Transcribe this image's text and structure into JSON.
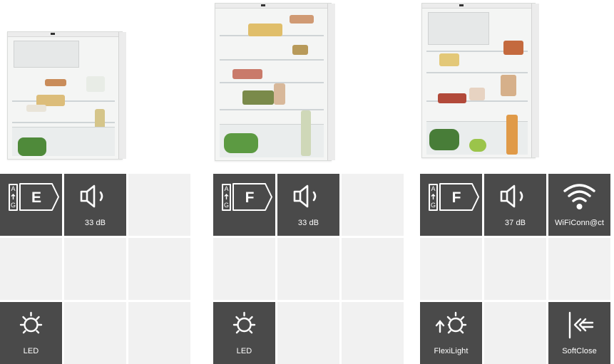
{
  "products": [
    {
      "energy_class": "E",
      "energy_scale": [
        "A",
        "G"
      ],
      "tiles": [
        {
          "type": "energy"
        },
        {
          "type": "noise",
          "icon": "speaker-icon",
          "label": "33 dB"
        },
        {
          "type": "empty"
        },
        {
          "type": "empty"
        },
        {
          "type": "empty"
        },
        {
          "type": "empty"
        },
        {
          "type": "feature",
          "icon": "light-bulb-icon",
          "label": "LED"
        },
        {
          "type": "empty"
        },
        {
          "type": "empty"
        }
      ]
    },
    {
      "energy_class": "F",
      "energy_scale": [
        "A",
        "G"
      ],
      "tiles": [
        {
          "type": "energy"
        },
        {
          "type": "noise",
          "icon": "speaker-icon",
          "label": "33 dB"
        },
        {
          "type": "empty"
        },
        {
          "type": "empty"
        },
        {
          "type": "empty"
        },
        {
          "type": "empty"
        },
        {
          "type": "feature",
          "icon": "light-bulb-icon",
          "label": "LED"
        },
        {
          "type": "empty"
        },
        {
          "type": "empty"
        }
      ]
    },
    {
      "energy_class": "F",
      "energy_scale": [
        "A",
        "G"
      ],
      "tiles": [
        {
          "type": "energy"
        },
        {
          "type": "noise",
          "icon": "speaker-icon",
          "label": "37 dB"
        },
        {
          "type": "feature",
          "icon": "wifi-icon",
          "label": "WiFiConn@ct"
        },
        {
          "type": "empty"
        },
        {
          "type": "empty"
        },
        {
          "type": "empty"
        },
        {
          "type": "feature",
          "icon": "flexilight-icon",
          "label": "FlexiLight"
        },
        {
          "type": "empty"
        },
        {
          "type": "feature",
          "icon": "softclose-icon",
          "label": "SoftClose"
        }
      ]
    }
  ],
  "colors": {
    "tile_dark": "#4a4a4a",
    "tile_light": "#f1f1f1",
    "icon": "#ffffff"
  }
}
